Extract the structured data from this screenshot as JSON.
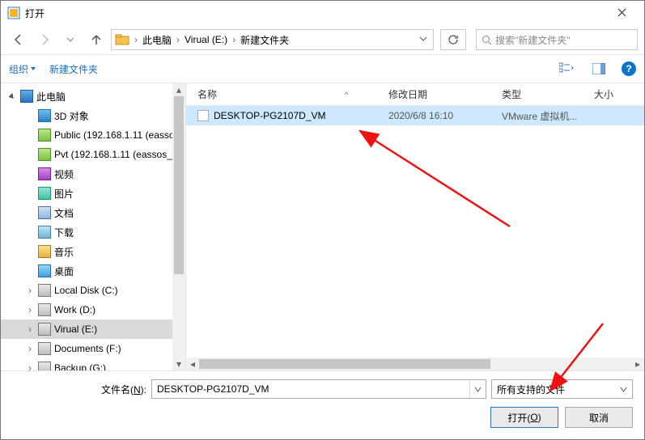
{
  "title": "打开",
  "breadcrumb": {
    "root": "此电脑",
    "mid": "Virual (E:)",
    "leaf": "新建文件夹"
  },
  "search": {
    "placeholder": "搜索\"新建文件夹\""
  },
  "toolbar": {
    "organize": "组织",
    "newfolder": "新建文件夹"
  },
  "columns": {
    "name": "名称",
    "date": "修改日期",
    "type": "类型",
    "size": "大小"
  },
  "tree": {
    "root": "此电脑",
    "items": [
      {
        "label": "3D 对象",
        "icon": "ico-cube"
      },
      {
        "label": "Public (192.168.1.11 (eassos",
        "icon": "ico-folder-net"
      },
      {
        "label": "Pvt (192.168.1.11 (eassos_",
        "icon": "ico-folder-net"
      },
      {
        "label": "视频",
        "icon": "ico-video"
      },
      {
        "label": "图片",
        "icon": "ico-image"
      },
      {
        "label": "文档",
        "icon": "ico-doc"
      },
      {
        "label": "下载",
        "icon": "ico-dl"
      },
      {
        "label": "音乐",
        "icon": "ico-music"
      },
      {
        "label": "桌面",
        "icon": "ico-desktop"
      },
      {
        "label": "Local Disk (C:)",
        "icon": "ico-drive"
      },
      {
        "label": "Work (D:)",
        "icon": "ico-drive"
      },
      {
        "label": "Virual (E:)",
        "icon": "ico-drive"
      },
      {
        "label": "Documents (F:)",
        "icon": "ico-drive"
      },
      {
        "label": "Backup (G:)",
        "icon": "ico-drive"
      }
    ]
  },
  "files": [
    {
      "name": "DESKTOP-PG2107D_VM",
      "date": "2020/6/8 16:10",
      "type": "VMware 虚拟机..."
    }
  ],
  "footer": {
    "filename_label_pre": "文件名(",
    "filename_label_u": "N",
    "filename_label_post": "):",
    "filename_value": "DESKTOP-PG2107D_VM",
    "filter": "所有支持的文件",
    "open_pre": "打开(",
    "open_u": "O",
    "open_post": ")",
    "cancel": "取消"
  }
}
